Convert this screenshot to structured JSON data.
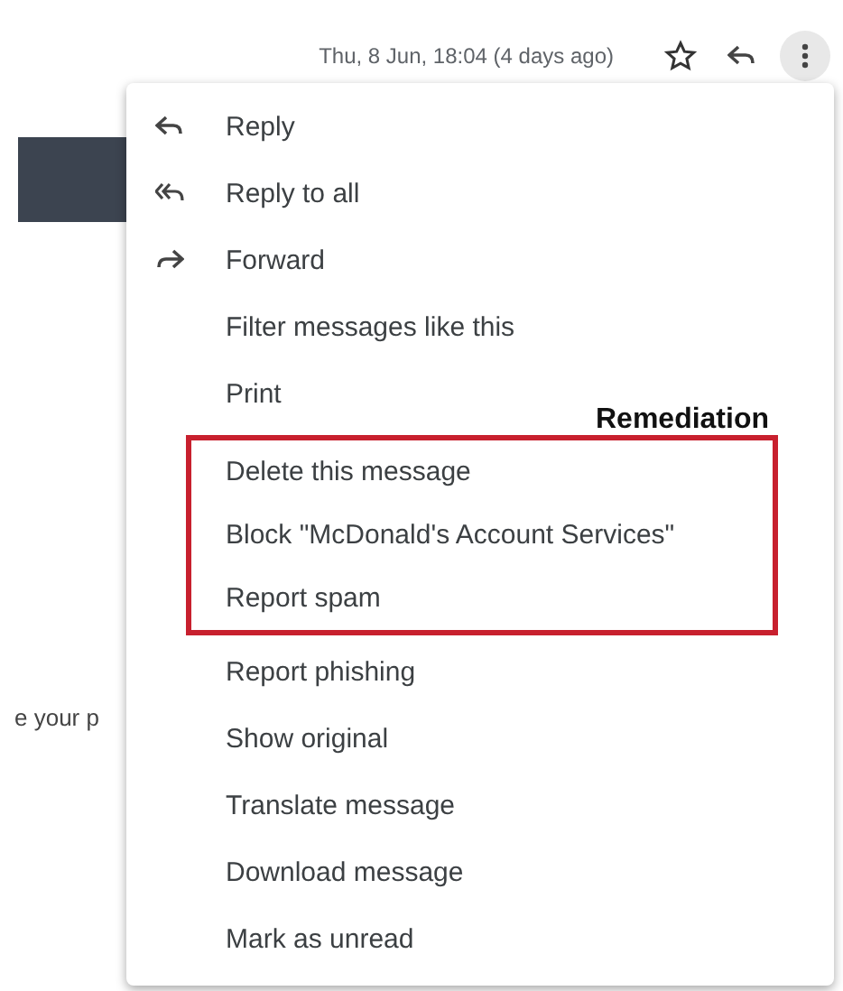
{
  "header": {
    "date": "Thu, 8 Jun, 18:04 (4 days ago)"
  },
  "background": {
    "text": "e your p"
  },
  "menu": {
    "groups": [
      {
        "items": [
          {
            "kind": "reply",
            "label": "Reply"
          },
          {
            "kind": "reply-all",
            "label": "Reply to all"
          },
          {
            "kind": "forward",
            "label": "Forward"
          },
          {
            "kind": "plain",
            "label": "Filter messages like this"
          },
          {
            "kind": "plain",
            "label": "Print"
          }
        ]
      },
      {
        "annotation": "Remediation",
        "items": [
          {
            "kind": "plain",
            "label": "Delete this message"
          },
          {
            "kind": "plain",
            "label": "Block \"McDonald's Account Services\""
          },
          {
            "kind": "plain",
            "label": "Report spam"
          }
        ]
      },
      {
        "items": [
          {
            "kind": "plain",
            "label": "Report phishing"
          },
          {
            "kind": "plain",
            "label": "Show original"
          },
          {
            "kind": "plain",
            "label": "Translate message"
          },
          {
            "kind": "plain",
            "label": "Download message"
          },
          {
            "kind": "plain",
            "label": "Mark as unread"
          }
        ]
      }
    ]
  }
}
